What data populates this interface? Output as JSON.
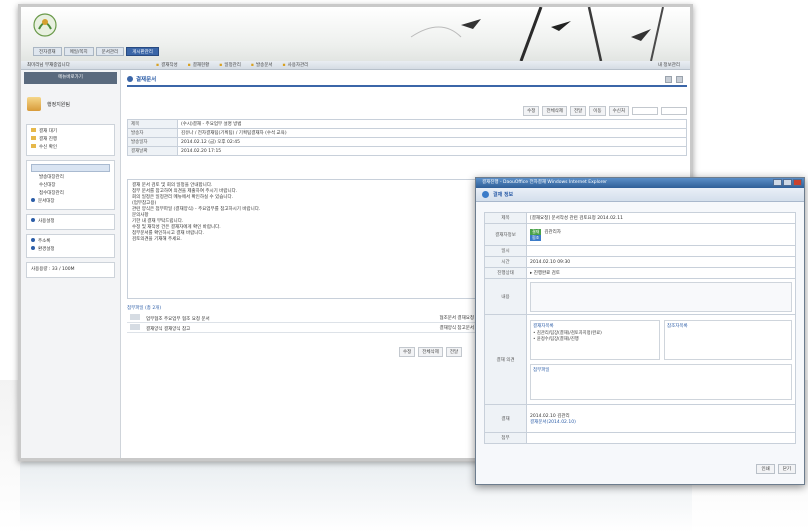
{
  "main": {
    "topnav": [
      "전자결재",
      "메일/쪽지",
      "문서관리",
      "게시판관리"
    ],
    "topnav_active": 3,
    "user": "최미리님 부재중입니다",
    "subtools": [
      "결재작성",
      "결재현황",
      "일정관리",
      "발송문서",
      "사용자관리"
    ],
    "subright": "내 정보관리",
    "left": {
      "header": "메뉴바로가기",
      "org": "행정지원팀",
      "group1": [
        "결재 대기",
        "결재 진행",
        "수신 확인"
      ],
      "group2_selected": "",
      "group2": [
        "발송대장관리",
        "수신대장",
        "접수대장관리",
        "문서대장"
      ],
      "group2_right": "",
      "group3": [
        "사용설정"
      ],
      "group4": [
        "주소록",
        "환경설정"
      ],
      "quota": "사용용량 : 33 / 100M"
    },
    "content": {
      "title": "결재문서",
      "tools": [
        "수정",
        "전체삭제",
        "전달",
        "이동",
        "수신처"
      ],
      "rows": [
        {
          "label": "제목",
          "value": "(수시)결재 - 주요업무 설명 방법"
        },
        {
          "label": "발송자",
          "value": "김유나 / 전자결재팀(기획팀) / 기획팀결재자 (수석 교육)"
        },
        {
          "label": "발송일자",
          "value": "2014.02.12 (금) 오후 02:45"
        },
        {
          "label": "결재날짜",
          "value": "2014.02.20 17:15"
        }
      ],
      "body": [
        "결재 문서 검토 및 회의 일정을 안내합니다.",
        "첨부 문서를 참고하여 의견을 제출하여 주시기 바랍니다.",
        "회의 일정은 일정관리 메뉴에서 확인하실 수 있습니다.",
        "(업무참고용)",
        "",
        "관련 양식은 첨부파일 (결재양식) - 주요업무를 참고하시기 바랍니다.",
        "",
        "문의사항",
        "기한 내 결재 부탁드립니다.",
        "수정 및 재작성 건은 결재자에게 확인 바랍니다.",
        "첨부문서를 확인하시고 결재 바랍니다.",
        "검토의견을 기재해 주세요."
      ],
      "attach_header": "첨부파일 (총 2개)",
      "attachments": [
        {
          "name": "업무협조",
          "file": "주요업무 협조 요청 문서"
        },
        {
          "name": "결재양식",
          "file": "결재양식 참고"
        }
      ],
      "attach_right": [
        "협조문서 결재요청",
        "결재양식 참고문서"
      ],
      "tools2": [
        "수정",
        "전체삭제",
        "전달"
      ]
    }
  },
  "dialog": {
    "window_title": "결재진행 - DaouOffice 전자결재 Windows Internet Explorer",
    "header": "결재 정보",
    "rows": {
      "subject_label": "제목",
      "subject": "[결재요청] 문서작성 관련 검토요청 2014.02.11",
      "approver_label": "결재자정보",
      "approver_tag": "결재",
      "approver_name": "김관리자",
      "approver_tag2": "협조",
      "date_label": "일시",
      "date": "2014.02.10 09:30",
      "time_label": "시간",
      "time": "2014.02.10 09:30",
      "status_label": "진행상태",
      "status": "▸ 진행완료 검토",
      "content_label": "내용",
      "opinion_label": "결재 의견",
      "panel1_title": "결재자목록",
      "panel1_items": [
        "김관리/팀장(결재)/검토자지정(완료)",
        "윤정수/팀장(결재)/진행"
      ],
      "panel2_title": "참조자목록",
      "panel3_title": "첨부파일",
      "sign_label": "결재",
      "sign_date": "2014.02.10  김관리",
      "sign_file": "결재문서(2014.02.10)",
      "extra_label": "첨부"
    },
    "buttons": [
      "인쇄",
      "닫기"
    ]
  }
}
